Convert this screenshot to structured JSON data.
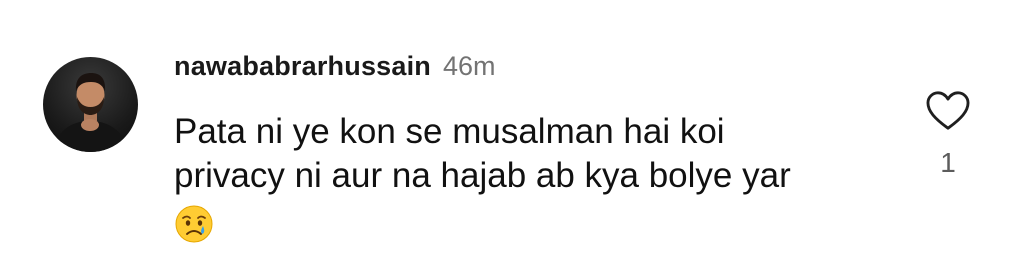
{
  "comment": {
    "username": "nawababrarhussain",
    "timestamp": "46m",
    "text_lines": [
      "Pata ni ye kon se musalman hai koi",
      "privacy ni aur na hajab ab kya bolye yar"
    ],
    "emoji": "crying-face",
    "likes": "1"
  },
  "colors": {
    "username": "#1a1a1a",
    "timestamp": "#737373",
    "text": "#111111",
    "like_count": "#5c5c5c",
    "heart_outline": "#1f1f1f"
  },
  "icons": {
    "like": "heart-outline-icon",
    "avatar": "profile-photo"
  }
}
